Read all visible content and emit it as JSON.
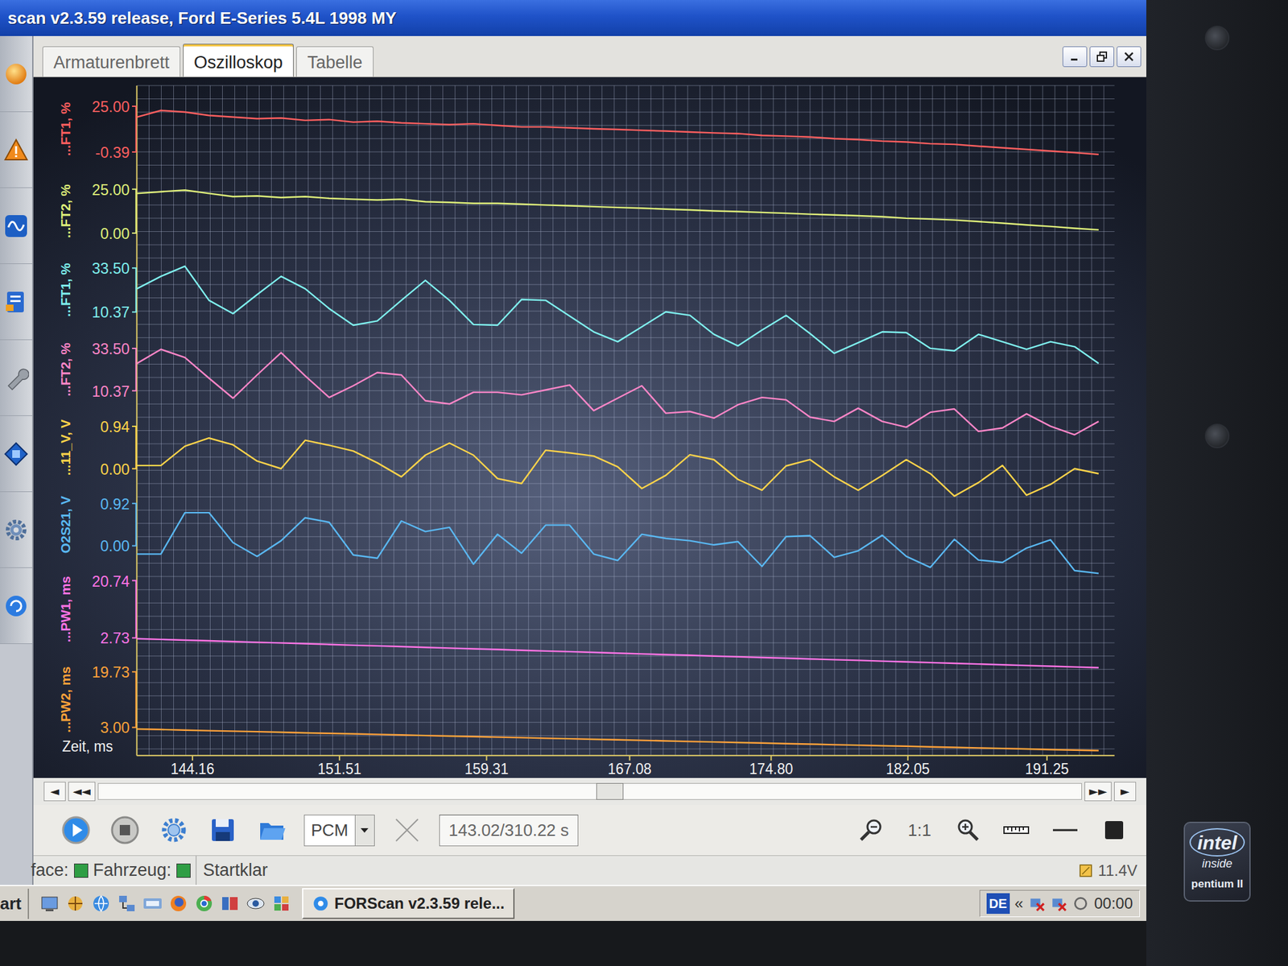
{
  "window": {
    "title": "scan v2.3.59 release, Ford E-Series 5.4L 1998 MY"
  },
  "tabs": [
    {
      "label": "Armaturenbrett",
      "selected": false
    },
    {
      "label": "Oszilloskop",
      "selected": true
    },
    {
      "label": "Tabelle",
      "selected": false
    }
  ],
  "chart": {
    "time_axis": {
      "label": "Zeit, ms",
      "ticks": [
        "144.16",
        "151.51",
        "159.31",
        "167.08",
        "174.80",
        "182.05",
        "191.25"
      ]
    },
    "series": [
      {
        "label": "...FT1, %",
        "max": "25.00",
        "min": "-0.39",
        "color": "#ff5f5f",
        "values": [
          19.0,
          22.7,
          21.8,
          19.9,
          19.0,
          18.1,
          18.5,
          17.2,
          17.6,
          16.2,
          16.7,
          15.8,
          15.3,
          14.8,
          15.3,
          14.4,
          13.5,
          13.5,
          13.0,
          12.5,
          12.1,
          11.6,
          11.2,
          10.7,
          10.2,
          9.8,
          8.8,
          8.4,
          7.9,
          7.0,
          6.5,
          5.6,
          5.1,
          4.2,
          3.8,
          2.8,
          1.9,
          1.0,
          0.1,
          -0.8,
          -1.8
        ]
      },
      {
        "label": "...FT2, %",
        "max": "25.00",
        "min": "0.00",
        "color": "#dff07a",
        "values": [
          22.6,
          23.6,
          24.5,
          22.6,
          20.8,
          21.2,
          20.3,
          20.8,
          19.8,
          19.3,
          18.9,
          19.3,
          17.9,
          17.5,
          17.0,
          17.0,
          16.5,
          16.0,
          15.6,
          15.1,
          14.6,
          14.2,
          13.7,
          13.2,
          12.7,
          12.3,
          11.8,
          11.3,
          10.8,
          10.4,
          9.9,
          9.4,
          8.5,
          8.0,
          7.5,
          6.6,
          5.7,
          4.7,
          3.8,
          2.8,
          1.9
        ]
      },
      {
        "label": "...FT1, %",
        "max": "33.50",
        "min": "10.37",
        "color": "#7ff0ee",
        "values": [
          22.6,
          29.1,
          34.4,
          16.5,
          9.5,
          19.5,
          29.1,
          22.6,
          12.1,
          3.4,
          5.6,
          16.5,
          27.0,
          16.5,
          3.8,
          3.4,
          16.9,
          16.5,
          8.2,
          -0.1,
          -5.3,
          2.5,
          10.4,
          8.6,
          -1.4,
          -7.5,
          0.8,
          8.6,
          -1.0,
          -11.4,
          -5.8,
          -0.1,
          -0.5,
          -8.8,
          -10.1,
          -1.4,
          -5.3,
          -9.3,
          -5.3,
          -7.9,
          -16.7
        ]
      },
      {
        "label": "...FT2, %",
        "max": "33.50",
        "min": "10.37",
        "color": "#ff86c8",
        "values": [
          25.3,
          33.0,
          28.5,
          17.2,
          6.3,
          19.0,
          31.2,
          18.5,
          6.7,
          13.1,
          20.3,
          19.0,
          4.9,
          3.1,
          9.5,
          9.5,
          8.1,
          10.8,
          13.5,
          -0.5,
          6.3,
          13.1,
          -1.9,
          -1.0,
          -4.6,
          2.7,
          6.7,
          5.4,
          -4.1,
          -6.4,
          0.8,
          -6.4,
          -9.6,
          -1.4,
          0.4,
          -11.9,
          -10.0,
          -2.3,
          -9.1,
          -13.7,
          -6.4
        ]
      },
      {
        "label": "...11_V, V",
        "max": "0.94",
        "min": "0.00",
        "color": "#ffd44a",
        "values": [
          0.07,
          0.07,
          0.5,
          0.68,
          0.53,
          0.17,
          0.0,
          0.63,
          0.52,
          0.39,
          0.13,
          -0.18,
          0.3,
          0.57,
          0.3,
          -0.22,
          -0.33,
          0.41,
          0.35,
          0.28,
          0.04,
          -0.44,
          -0.15,
          0.31,
          0.2,
          -0.24,
          -0.48,
          0.06,
          0.2,
          -0.18,
          -0.48,
          -0.15,
          0.2,
          -0.11,
          -0.61,
          -0.31,
          0.07,
          -0.59,
          -0.35,
          0.0,
          -0.11
        ]
      },
      {
        "label": "O2S21, V",
        "max": "0.92",
        "min": "0.00",
        "color": "#5ab8f2",
        "values": [
          -0.18,
          -0.18,
          0.72,
          0.72,
          0.07,
          -0.23,
          0.11,
          0.61,
          0.51,
          -0.2,
          -0.27,
          0.54,
          0.31,
          0.4,
          -0.4,
          0.25,
          -0.16,
          0.45,
          0.45,
          -0.18,
          -0.32,
          0.25,
          0.16,
          0.11,
          0.02,
          0.09,
          -0.45,
          0.2,
          0.22,
          -0.25,
          -0.11,
          0.23,
          -0.23,
          -0.47,
          0.14,
          -0.31,
          -0.36,
          -0.05,
          0.13,
          -0.54,
          -0.6
        ]
      },
      {
        "label": "...PW1, ms",
        "max": "20.74",
        "min": "2.73",
        "color": "#ff74e6",
        "values": [
          2.47,
          2.24,
          2.01,
          1.78,
          1.56,
          1.33,
          1.1,
          0.87,
          0.64,
          0.41,
          0.19,
          -0.04,
          -0.27,
          -0.5,
          -0.73,
          -0.96,
          -1.19,
          -1.41,
          -1.64,
          -1.87,
          -2.1,
          -2.33,
          -2.56,
          -2.78,
          -3.01,
          -3.24,
          -3.47,
          -3.7,
          -3.93,
          -4.16,
          -4.38,
          -4.61,
          -4.84,
          -5.07,
          -5.3,
          -5.53,
          -5.75,
          -5.98,
          -6.21,
          -6.44,
          -6.67
        ]
      },
      {
        "label": "...PW2, ms",
        "max": "19.73",
        "min": "3.00",
        "color": "#ffa23a",
        "values": [
          2.5,
          2.34,
          2.18,
          2.01,
          1.85,
          1.69,
          1.53,
          1.36,
          1.2,
          1.04,
          0.88,
          0.71,
          0.55,
          0.39,
          0.23,
          0.06,
          -0.1,
          -0.26,
          -0.43,
          -0.59,
          -0.75,
          -0.91,
          -1.08,
          -1.24,
          -1.4,
          -1.56,
          -1.73,
          -1.89,
          -2.05,
          -2.21,
          -2.38,
          -2.54,
          -2.7,
          -2.86,
          -3.03,
          -3.19,
          -3.35,
          -3.51,
          -3.68,
          -3.84,
          -4.0
        ]
      }
    ]
  },
  "scrollbar": {
    "left": [
      "◄",
      "◄◄"
    ],
    "right": [
      "►►",
      "►"
    ],
    "level": 0.52
  },
  "toolbar": {
    "module": "PCM",
    "position": "143.02/310.22 s",
    "zoom_reset": "1:1"
  },
  "status_bar": {
    "indicators": [
      {
        "label": "face:",
        "color": "#2f9e44"
      },
      {
        "label": "Fahrzeug:",
        "color": "#2f9e44"
      }
    ],
    "state": "Startklar",
    "voltage": "11.4V"
  },
  "taskbar": {
    "start": "art",
    "task": "FORScan v2.3.59 rele...",
    "language": "DE",
    "expand": "«",
    "clock": "00:00"
  },
  "sticker": {
    "brand": "intel",
    "line": "inside",
    "cpu": "pentium II"
  }
}
